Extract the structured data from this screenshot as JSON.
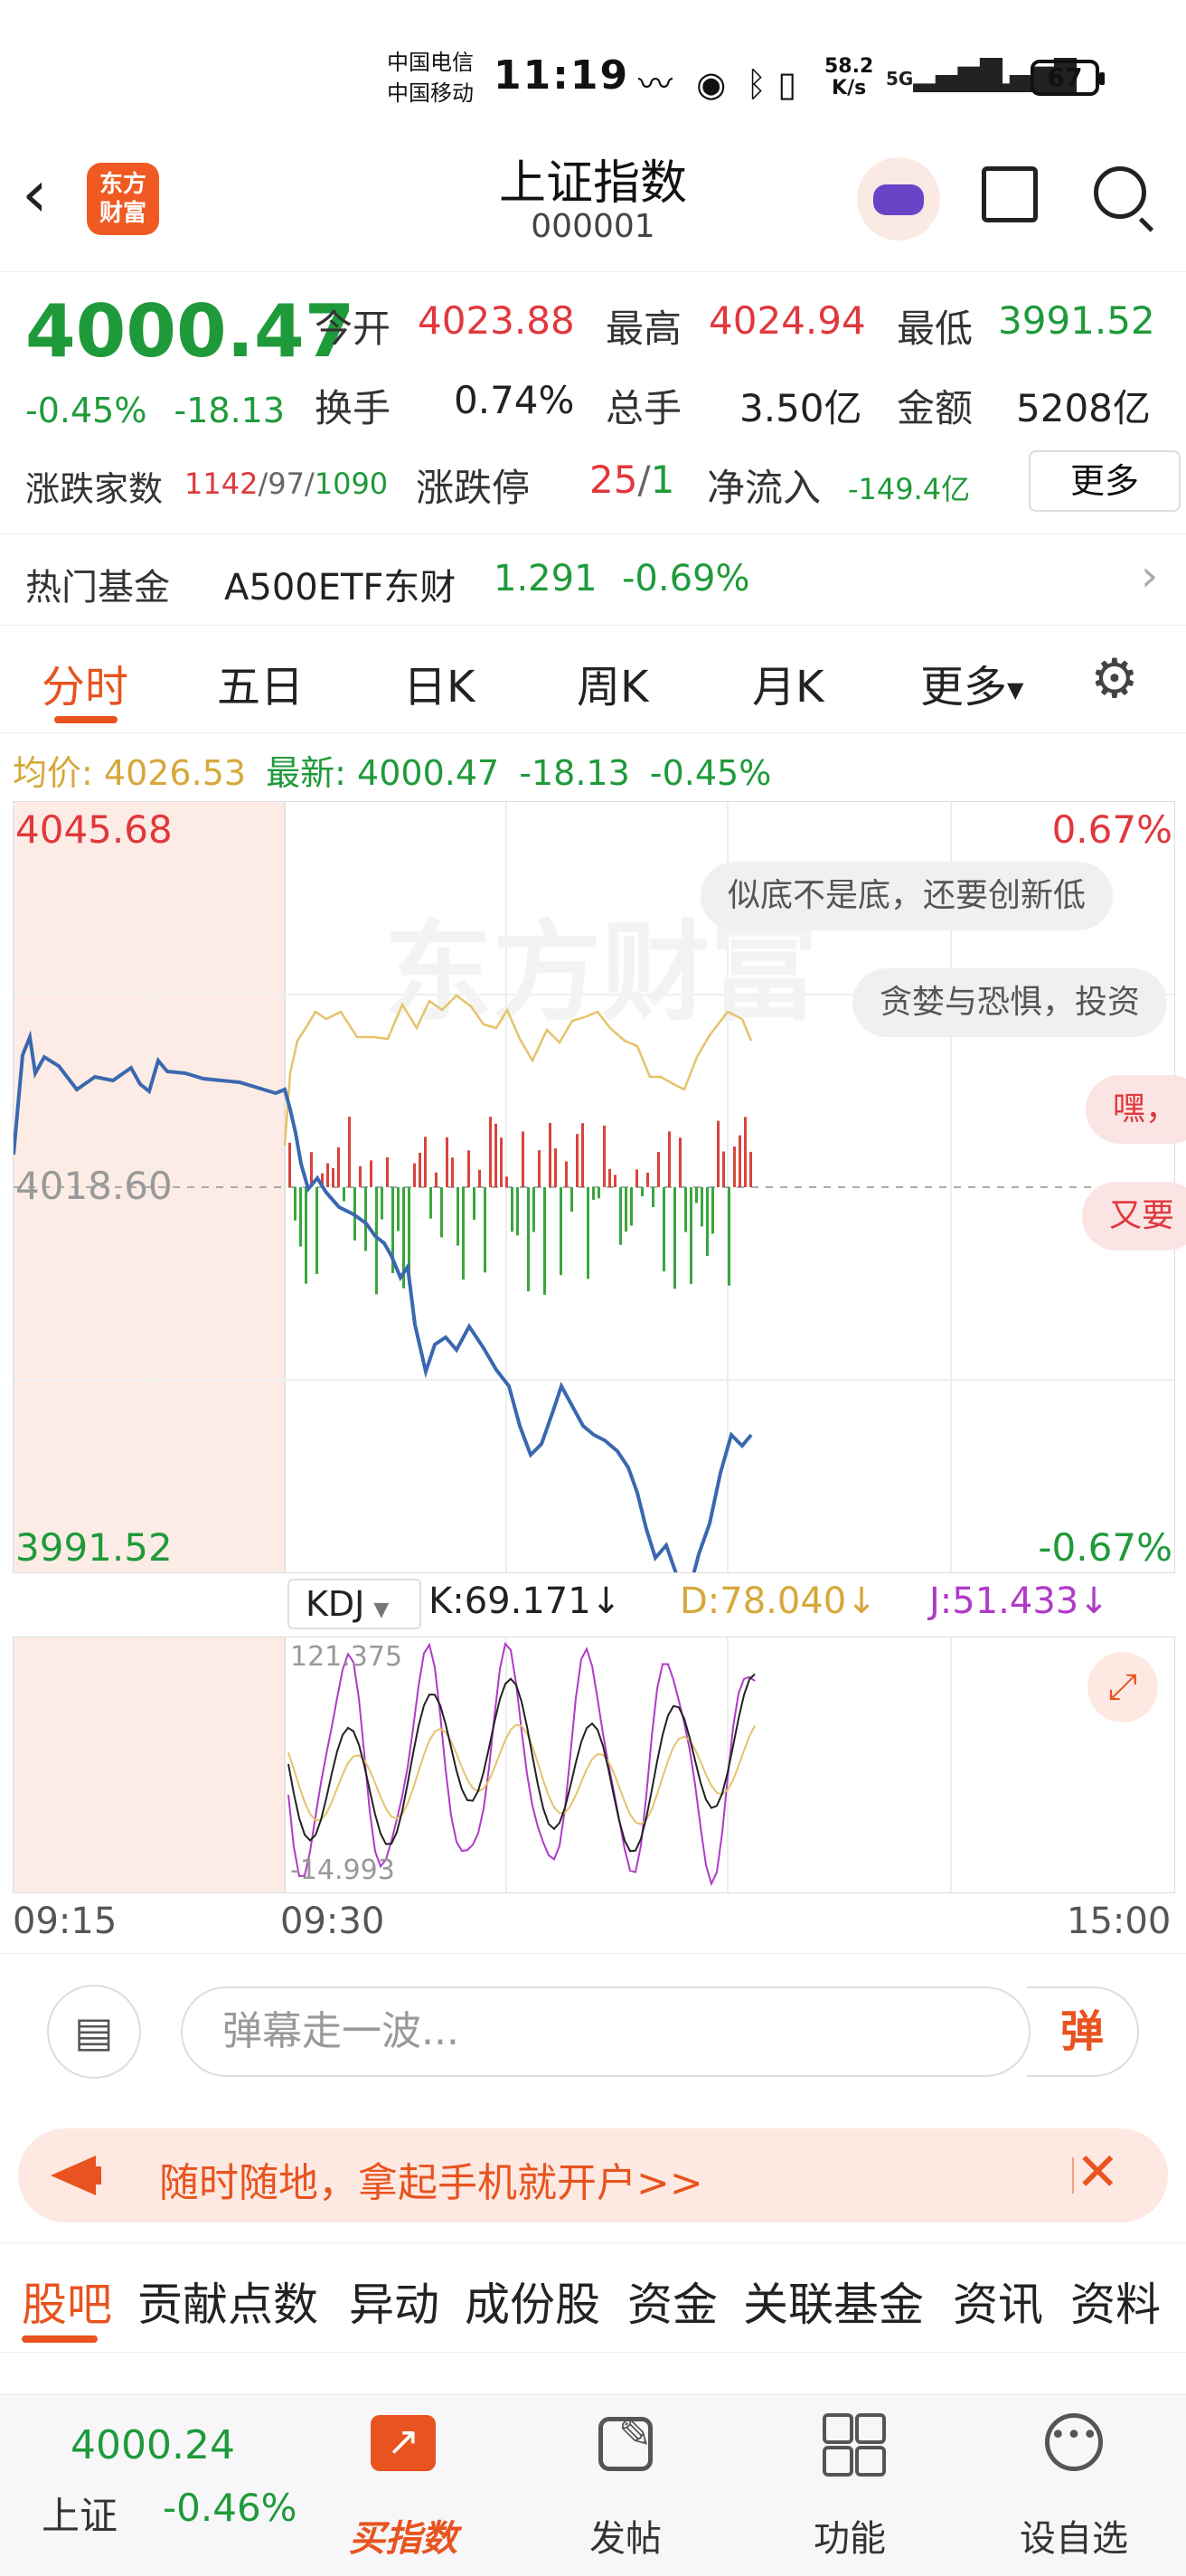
{
  "status_bar": {
    "carrier1": "中国电信",
    "carrier2": "中国移动",
    "time": "11:19",
    "speed_value": "58.2",
    "speed_unit": "K/s",
    "net1": "5G",
    "net2": "5G",
    "battery": "67"
  },
  "header": {
    "logo_line1": "东方",
    "logo_line2": "财富",
    "title": "上证指数",
    "code": "000001"
  },
  "quote": {
    "price": "4000.47",
    "change_pct": "-0.45%",
    "change_abs": "-18.13",
    "open_label": "今开",
    "open": "4023.88",
    "high_label": "最高",
    "high": "4024.94",
    "low_label": "最低",
    "low": "3991.52",
    "turnover_label": "换手",
    "turnover": "0.74%",
    "volume_label": "总手",
    "volume": "3.50亿",
    "amount_label": "金额",
    "amount": "5208亿",
    "adv_label": "涨跌家数",
    "adv_up": "1142",
    "adv_flat": "97",
    "adv_down": "1090",
    "limit_label": "涨跌停",
    "limit_up": "25",
    "limit_down": "1",
    "netflow_label": "净流入",
    "netflow": "-149.4亿",
    "more_button": "更多"
  },
  "hot_fund": {
    "label": "热门基金",
    "name": "A500ETF东财",
    "price": "1.291",
    "change": "-0.69%"
  },
  "tabs": [
    "分时",
    "五日",
    "日K",
    "周K",
    "月K",
    "更多"
  ],
  "avg_bar": {
    "avg_label": "均价:",
    "avg_value": "4026.53",
    "latest_label": "最新:",
    "latest_value": "4000.47",
    "latest_change": "-18.13",
    "latest_pct": "-0.45%"
  },
  "chart": {
    "y_top": "4045.68",
    "y_mid": "4018.60",
    "y_bottom": "3991.52",
    "pct_top": "0.67%",
    "pct_bottom": "-0.67%",
    "watermark": "东方财富",
    "bubbles": [
      "似底不是底，还要创新低",
      "贪婪与恐惧，投资",
      "嘿，",
      "又要"
    ]
  },
  "kdj": {
    "selector": "KDJ",
    "k": "K:69.171↓",
    "d": "D:78.040↓",
    "j": "J:51.433↓",
    "y_top": "121.375",
    "y_bottom": "-14.993"
  },
  "time_axis": [
    "09:15",
    "09:30",
    "15:00"
  ],
  "danmu": {
    "placeholder": "弹幕走一波...",
    "send": "弹"
  },
  "banner": {
    "text": "随时随地，拿起手机就开户>>"
  },
  "subtabs": [
    "股吧",
    "贡献点数",
    "异动",
    "成份股",
    "资金",
    "关联基金",
    "资讯",
    "资料"
  ],
  "bottom_nav": {
    "index_price": "4000.24",
    "index_name": "上证",
    "index_change": "-0.46%",
    "buy_label": "买指数",
    "post_label": "发帖",
    "func_label": "功能",
    "watch_label": "设自选"
  }
}
